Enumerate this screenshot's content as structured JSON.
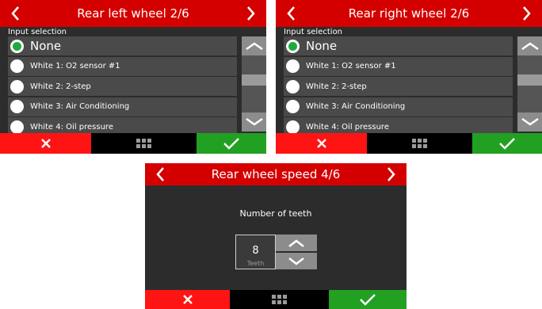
{
  "screens": {
    "left": {
      "title": "Rear left wheel 2/6",
      "section_label": "Input selection",
      "items": [
        {
          "label": "None",
          "selected": true
        },
        {
          "label": "White 1: O2 sensor #1",
          "selected": false
        },
        {
          "label": "White 2: 2-step",
          "selected": false
        },
        {
          "label": "White 3: Air Conditioning",
          "selected": false
        },
        {
          "label": "White 4: Oil pressure",
          "selected": false
        }
      ]
    },
    "right": {
      "title": "Rear right wheel 2/6",
      "section_label": "Input selection",
      "items": [
        {
          "label": "None",
          "selected": true
        },
        {
          "label": "White 1: O2 sensor #1",
          "selected": false
        },
        {
          "label": "White 2: 2-step",
          "selected": false
        },
        {
          "label": "White 3: Air Conditioning",
          "selected": false
        },
        {
          "label": "White 4: Oil pressure",
          "selected": false
        }
      ]
    },
    "bottom": {
      "title": "Rear wheel speed 4/6",
      "caption": "Number of teeth",
      "value": "8",
      "unit": "Teeth"
    }
  },
  "icons": {
    "nav_prev": "chevron-left-icon",
    "nav_next": "chevron-right-icon",
    "scroll_up": "chevron-up-icon",
    "scroll_down": "chevron-down-icon",
    "cancel": "cross-icon",
    "menu": "grid-icon",
    "confirm": "check-icon"
  },
  "colors": {
    "title_bar": "#d40000",
    "cancel": "#ff1414",
    "confirm": "#22a022",
    "selected_radio": "#1faa3b",
    "panel_bg": "#2c2c2c",
    "item_bg": "#4a4a4a"
  }
}
